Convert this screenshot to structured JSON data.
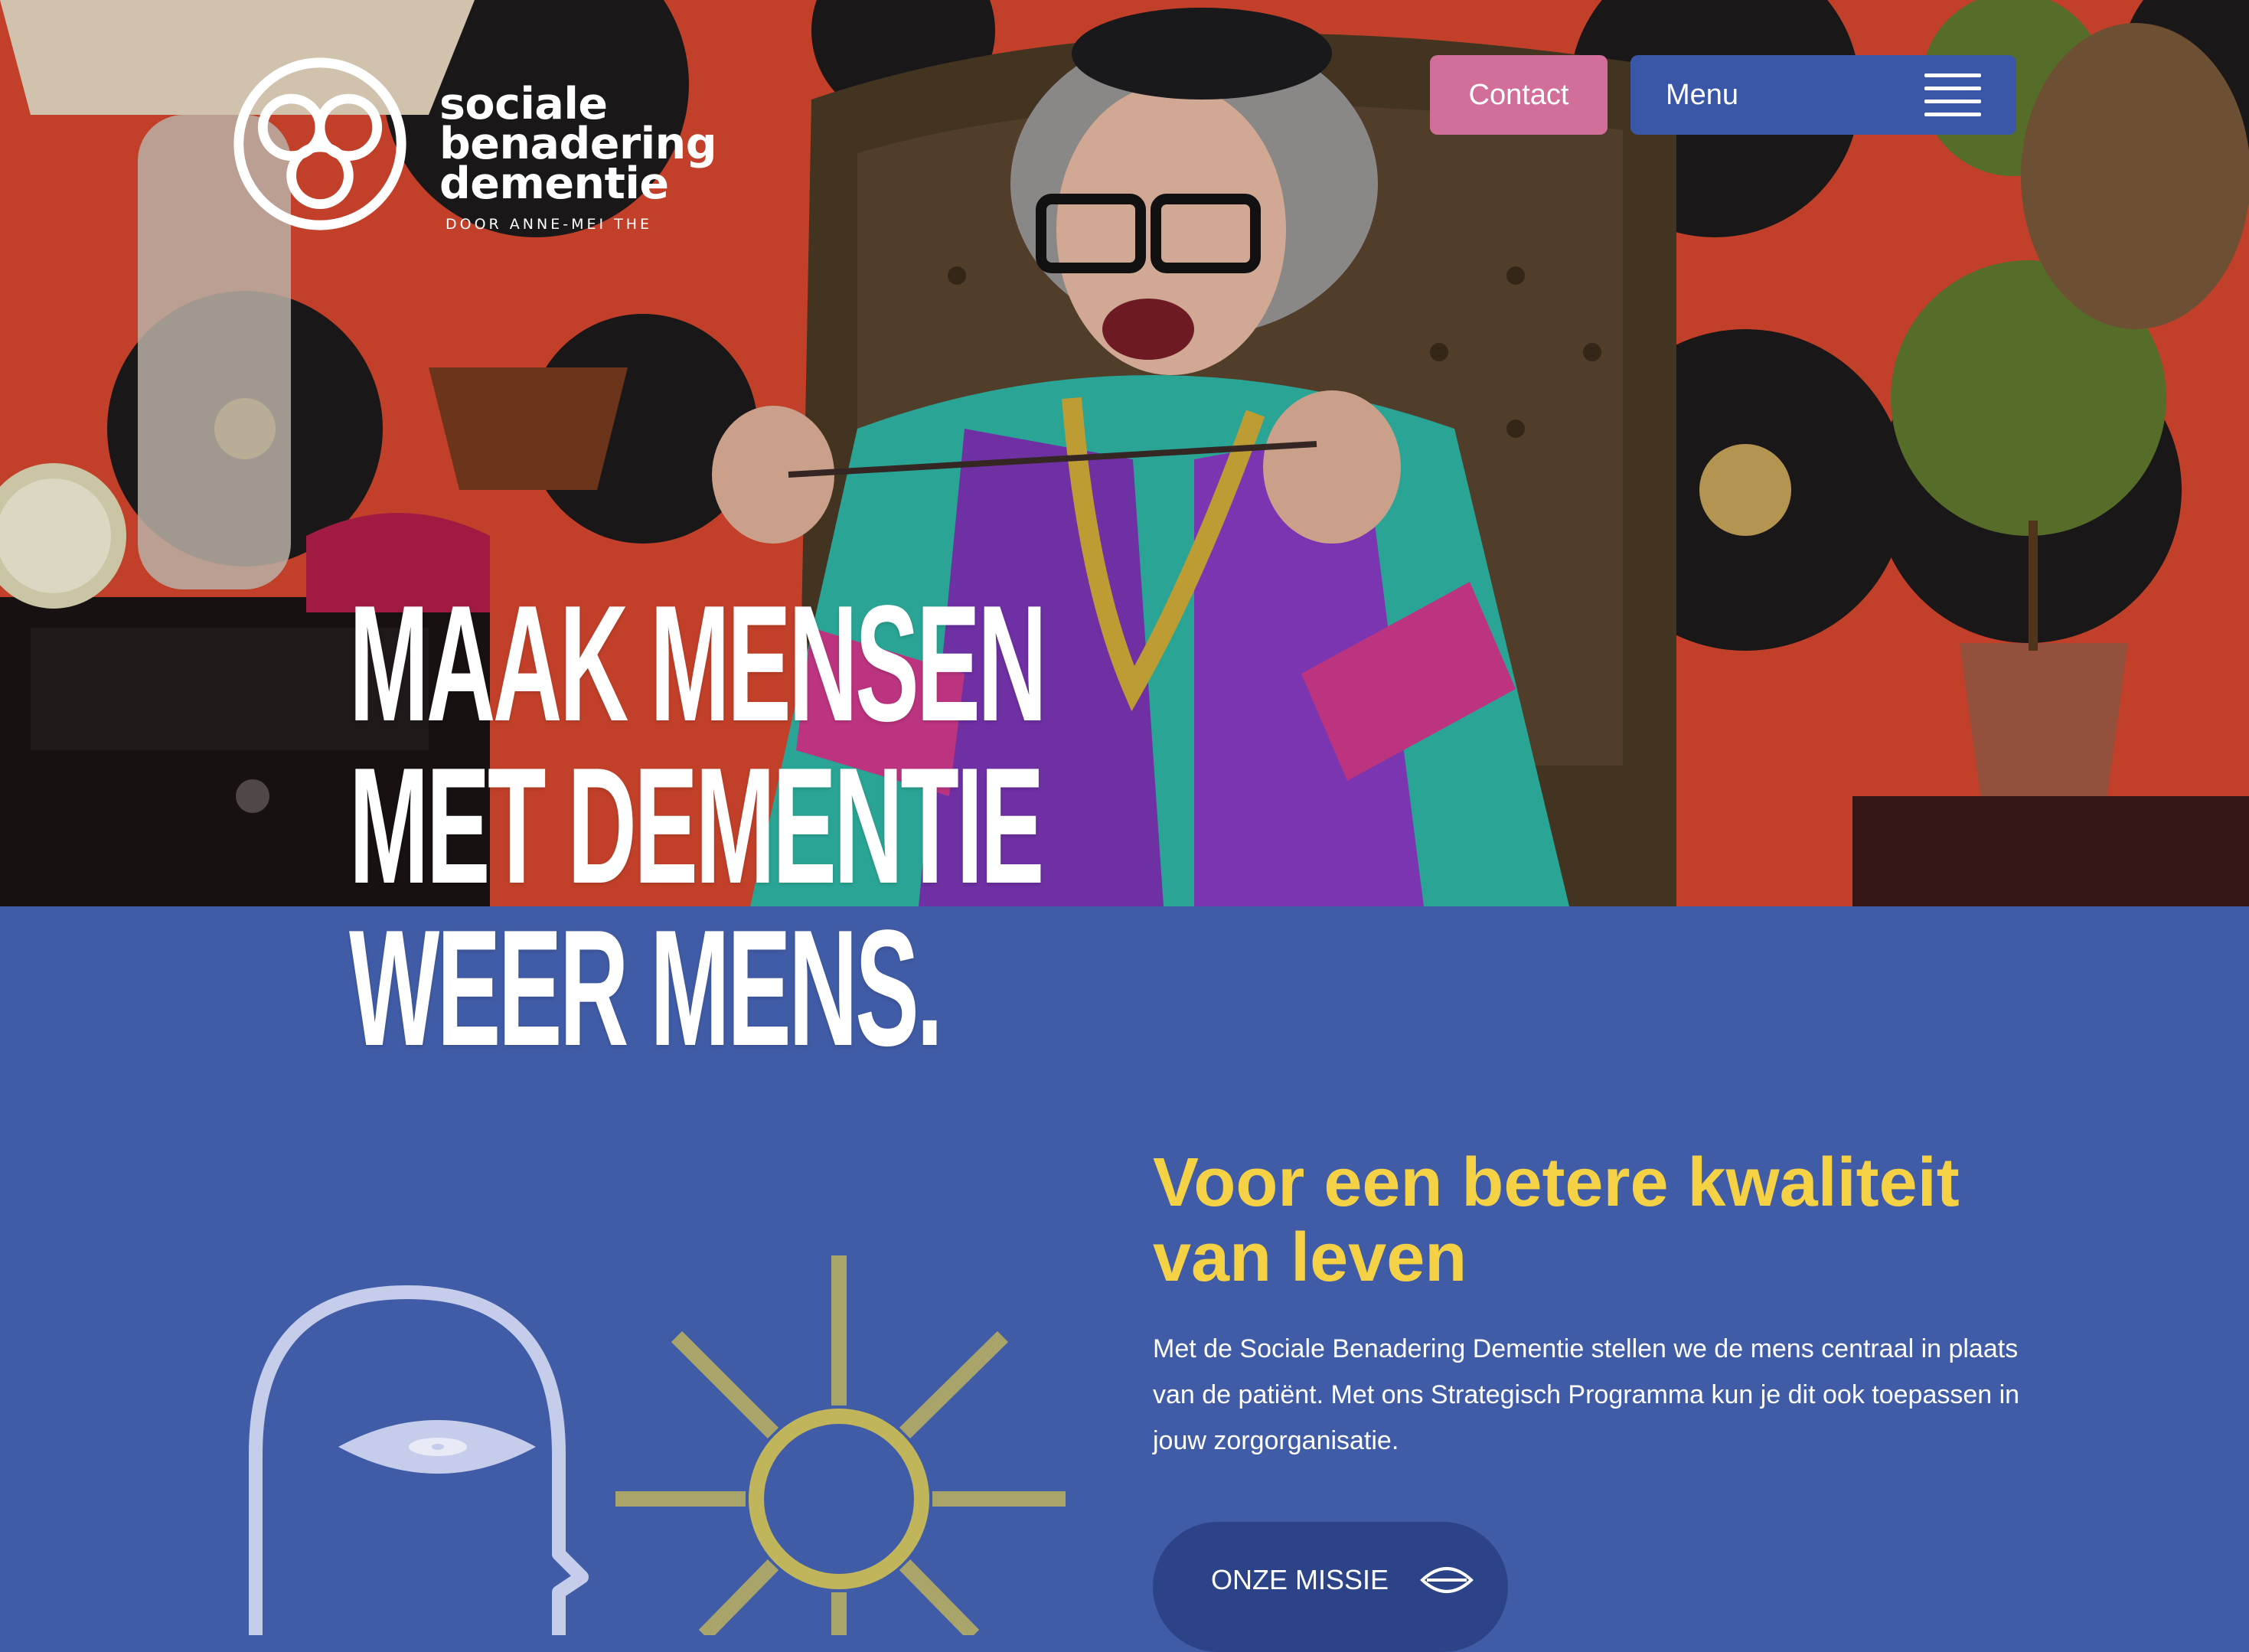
{
  "brand": {
    "name_lines": [
      "sociale",
      "benadering",
      "dementie"
    ],
    "tagline": "DOOR ANNE-MEI THE"
  },
  "header": {
    "contact_label": "Contact",
    "menu_label": "Menu",
    "menu_icon": "hamburger-icon"
  },
  "hero": {
    "headline_lines": [
      "MAAK MENSEN",
      "MET DEMENTIE",
      "WEER MENS."
    ],
    "image_subject": "hero-photo"
  },
  "mission": {
    "title": "Voor een betere kwaliteit van leven",
    "body": "Met de Sociale Benadering Dementie stellen we de mens centraal in plaats van de patiënt. Met ons Strategisch Programma kun je dit ook toepassen in jouw zorgorganisatie.",
    "button_label": "ONZE MISSIE",
    "button_icon": "eye-icon"
  },
  "colors": {
    "section_bg": "#415ca7",
    "accent_yellow": "#f5d245",
    "contact_pink": "#d16e9a",
    "menu_blue": "#3a56a6",
    "button_dark_blue": "#2c4487"
  }
}
